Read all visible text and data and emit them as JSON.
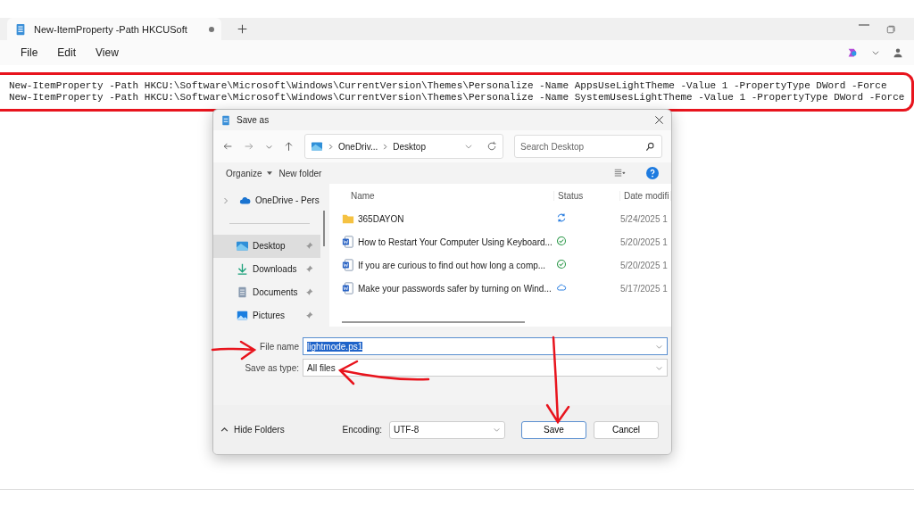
{
  "tab": {
    "title": "New-ItemProperty -Path HKCUSoft",
    "unsaved": true
  },
  "menu": [
    "File",
    "Edit",
    "View"
  ],
  "editor": {
    "highlighted": true,
    "lines": [
      "New-ItemProperty -Path HKCU:\\Software\\Microsoft\\Windows\\CurrentVersion\\Themes\\Personalize -Name AppsUseLightTheme -Value 1 -PropertyType DWord -Force",
      "New-ItemProperty -Path HKCU:\\Software\\Microsoft\\Windows\\CurrentVersion\\Themes\\Personalize -Name SystemUsesLightTheme -Value 1 -PropertyType DWord -Force"
    ]
  },
  "dialog": {
    "title": "Save as",
    "breadcrumb": [
      "OneDriv...",
      "Desktop"
    ],
    "search": {
      "placeholder": "Search Desktop"
    },
    "toolbar": {
      "organize": "Organize",
      "new_folder": "New folder"
    },
    "sidebar": {
      "items": [
        {
          "label": "OneDrive - Pers",
          "kind": "cloud",
          "selected": false,
          "pinned": false
        },
        {
          "label": "Desktop",
          "kind": "desktop",
          "selected": true,
          "pinned": true
        },
        {
          "label": "Downloads",
          "kind": "download",
          "selected": false,
          "pinned": true
        },
        {
          "label": "Documents",
          "kind": "document",
          "selected": false,
          "pinned": true
        },
        {
          "label": "Pictures",
          "kind": "picture",
          "selected": false,
          "pinned": true
        }
      ]
    },
    "columns": [
      "Name",
      "Status",
      "Date modifi"
    ],
    "rows": [
      {
        "name": "365DAYON",
        "kind": "folder",
        "status": {
          "kind": "syncing"
        },
        "date": "5/24/2025 1"
      },
      {
        "name": "How to Restart Your Computer Using Keyboard...",
        "kind": "word",
        "status": {
          "kind": "synced"
        },
        "date": "5/20/2025 1"
      },
      {
        "name": "If you are curious to find out how long a comp...",
        "kind": "word",
        "status": {
          "kind": "synced"
        },
        "date": "5/20/2025 1"
      },
      {
        "name": "Make your passwords safer by turning on Wind...",
        "kind": "word",
        "status": {
          "kind": "cloud"
        },
        "date": "5/17/2025 1"
      }
    ],
    "file_name": {
      "label": "File name",
      "value": "lightmode.ps1",
      "selected": true
    },
    "save_type": {
      "label": "Save as type:",
      "value": "All files"
    },
    "hide_folders": "Hide Folders",
    "encoding": {
      "label": "Encoding:",
      "value": "UTF-8"
    },
    "buttons": [
      {
        "label": "Save",
        "default": true
      },
      {
        "label": "Cancel",
        "default": false
      }
    ]
  }
}
